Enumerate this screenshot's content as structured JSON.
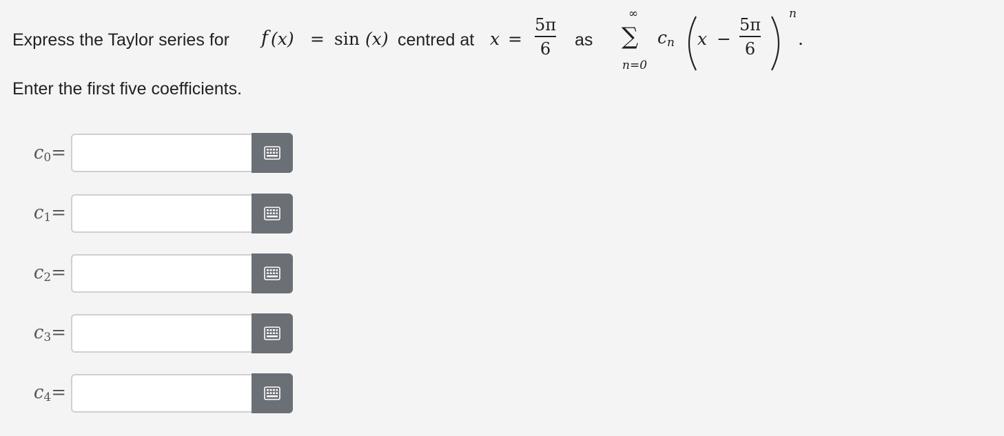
{
  "question": {
    "prefix": "Express the Taylor series for",
    "fx": "f",
    "fx_arg": "(x)",
    "equals": "=",
    "sin": "sin",
    "sin_arg": "(x)",
    "centred": "centred at",
    "xvar": "x",
    "frac_num": "5π",
    "frac_den": "6",
    "as": "as",
    "sum_symbol": "∑",
    "sum_upper": "∞",
    "sum_lower": "n=0",
    "cn": "c",
    "cn_sub": "n",
    "paren_x": "x",
    "minus": "−",
    "exponent": "n",
    "period": ".",
    "instruction": "Enter the first five coefficients."
  },
  "answers": [
    {
      "var": "c",
      "sub": "0",
      "eq": "=",
      "value": "",
      "placeholder": ""
    },
    {
      "var": "c",
      "sub": "1",
      "eq": "=",
      "value": "",
      "placeholder": ""
    },
    {
      "var": "c",
      "sub": "2",
      "eq": "=",
      "value": "",
      "placeholder": ""
    },
    {
      "var": "c",
      "sub": "3",
      "eq": "=",
      "value": "",
      "placeholder": ""
    },
    {
      "var": "c",
      "sub": "4",
      "eq": "=",
      "value": "",
      "placeholder": ""
    }
  ],
  "icons": {
    "keyboard_button": "keypad-icon"
  },
  "colors": {
    "background": "#f4f4f4",
    "button": "#6b6f76",
    "input_border": "#cfcfcf"
  }
}
